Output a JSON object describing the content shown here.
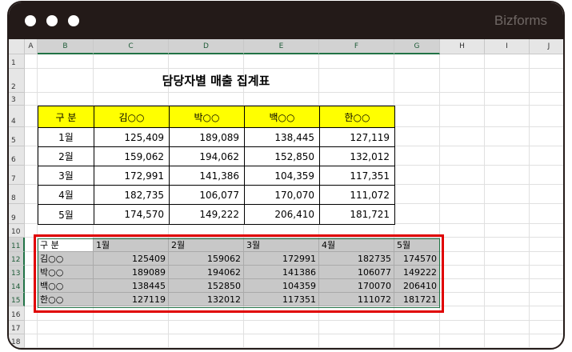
{
  "window": {
    "brand": "Bizforms"
  },
  "columns": [
    "A",
    "B",
    "C",
    "D",
    "E",
    "F",
    "G",
    "H",
    "I",
    "J"
  ],
  "rows": [
    "1",
    "2",
    "3",
    "4",
    "5",
    "6",
    "7",
    "8",
    "9",
    "10",
    "11",
    "12",
    "13",
    "14",
    "15",
    "16",
    "17",
    "18"
  ],
  "title": "담당자별 매출 집계표",
  "table1": {
    "header": [
      "구 분",
      "김○○",
      "박○○",
      "백○○",
      "한○○"
    ],
    "rows": [
      [
        "1월",
        "125,409",
        "189,089",
        "138,445",
        "127,119"
      ],
      [
        "2월",
        "159,062",
        "194,062",
        "152,850",
        "132,012"
      ],
      [
        "3월",
        "172,991",
        "141,386",
        "104,359",
        "117,351"
      ],
      [
        "4월",
        "182,735",
        "106,077",
        "170,070",
        "111,072"
      ],
      [
        "5월",
        "174,570",
        "149,222",
        "206,410",
        "181,721"
      ]
    ]
  },
  "table2": {
    "header": [
      "구 분",
      "1월",
      "2월",
      "3월",
      "4월",
      "5월"
    ],
    "rows": [
      [
        "김○○",
        "125409",
        "159062",
        "172991",
        "182735",
        "174570"
      ],
      [
        "박○○",
        "189089",
        "194062",
        "141386",
        "106077",
        "149222"
      ],
      [
        "백○○",
        "138445",
        "152850",
        "104359",
        "170070",
        "206410"
      ],
      [
        "한○○",
        "127119",
        "132012",
        "117351",
        "111072",
        "181721"
      ]
    ]
  },
  "colors": {
    "highlight": "#ffff00",
    "selection_box": "#e00000",
    "excel_green": "#217346"
  }
}
